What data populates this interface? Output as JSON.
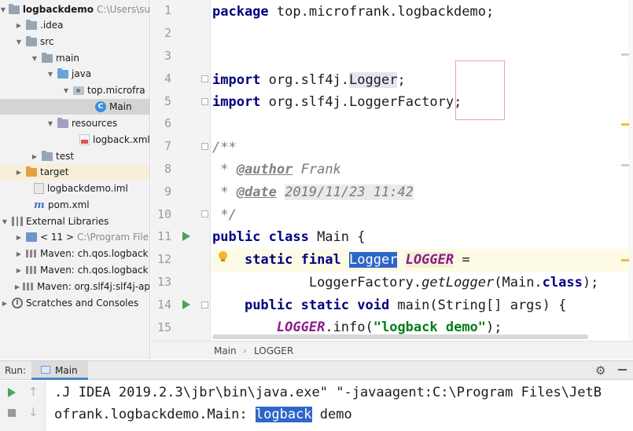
{
  "project_tree": {
    "root": {
      "label": "logbackdemo",
      "hint": "C:\\Users\\su"
    },
    "items": [
      {
        "label": ".idea"
      },
      {
        "label": "src"
      },
      {
        "label": "main"
      },
      {
        "label": "java"
      },
      {
        "label": "top.microfra"
      },
      {
        "label": "Main"
      },
      {
        "label": "resources"
      },
      {
        "label": "logback.xml"
      },
      {
        "label": "test"
      },
      {
        "label": "target"
      },
      {
        "label": "logbackdemo.iml"
      },
      {
        "label": "pom.xml"
      },
      {
        "label": "External Libraries"
      },
      {
        "label": "< 11 >",
        "hint": "C:\\Program File"
      },
      {
        "label": "Maven: ch.qos.logback"
      },
      {
        "label": "Maven: ch.qos.logback"
      },
      {
        "label": "Maven: org.slf4j:slf4j-ap"
      },
      {
        "label": "Scratches and Consoles"
      }
    ]
  },
  "editor": {
    "line_numbers": [
      "1",
      "2",
      "3",
      "4",
      "5",
      "6",
      "7",
      "8",
      "9",
      "10",
      "11",
      "12",
      "13",
      "14",
      "15"
    ],
    "code": {
      "l1_kw": "package",
      "l1_rest": " top.microfrank.logbackdemo;",
      "l4_kw": "import",
      "l4_a": " org.",
      "l4_b": "slf4j",
      "l4_c": ".",
      "l4_d": "Logger",
      "l4_e": ";",
      "l5_kw": "import",
      "l5_a": " org.",
      "l5_b": "slf4j",
      "l5_c": ".",
      "l5_d": "LoggerFactory",
      "l5_e": ";",
      "l7": "/**",
      "l8_a": " * ",
      "l8_tag": "@author",
      "l8_val": " Frank",
      "l9_a": " * ",
      "l9_tag": "@date",
      "l9_sp": " ",
      "l9_val": "2019/11/23 11:42",
      "l10": " */",
      "l11_kw": "public class",
      "l11_rest": " Main {",
      "l12_indent": "    ",
      "l12_kw": "static final",
      "l12_sp": " ",
      "l12_type": "Logger",
      "l12_sp2": " ",
      "l12_const": "LOGGER",
      "l12_rest": " =",
      "l13_indent": "            ",
      "l13_a": "LoggerFactory.",
      "l13_meth": "getLogger",
      "l13_b": "(Main.",
      "l13_kw": "class",
      "l13_c": ");",
      "l14_indent": "    ",
      "l14_kw": "public static void",
      "l14_rest": " main(String[] args) {",
      "l15_indent": "        ",
      "l15_const": "LOGGER",
      "l15_a": ".info(",
      "l15_str": "\"logback demo\"",
      "l15_b": ");"
    }
  },
  "breadcrumb": {
    "items": [
      "Main",
      "LOGGER"
    ],
    "separator": "›"
  },
  "run_panel": {
    "label": "Run:",
    "tab_label": "Main",
    "console_line1": ".J IDEA 2019.2.3\\jbr\\bin\\java.exe\" \"-javaagent:C:\\Program Files\\JetB",
    "console_line2_a": "ofrank.logbackdemo.Main: ",
    "console_line2_sel": "logback",
    "console_line2_b": " demo"
  },
  "colors": {
    "keyword": "#000080",
    "string": "#067d17",
    "constant": "#8a1a8a",
    "selection": "#2f65ca",
    "run_green": "#4aa457"
  }
}
